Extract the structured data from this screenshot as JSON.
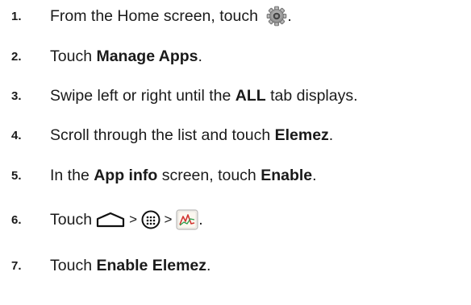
{
  "steps": [
    {
      "number": "1.",
      "before": "From the Home screen, touch ",
      "icon": "settings-gear-icon",
      "after": "."
    },
    {
      "number": "2.",
      "before": "Touch ",
      "bold": "Manage Apps",
      "after": "."
    },
    {
      "number": "3.",
      "before": "Swipe left or right until the ",
      "bold": "ALL",
      "after": " tab displays."
    },
    {
      "number": "4.",
      "before": "Scroll through the list and touch ",
      "bold": "Elemez",
      "after": "."
    },
    {
      "number": "5.",
      "before": "In the ",
      "bold": "App info",
      "middle": " screen, touch ",
      "bold2": "Enable",
      "after": "."
    },
    {
      "number": "6.",
      "before": "Touch ",
      "sep1": " > ",
      "sep2": " > ",
      "after": ".",
      "icons": [
        "home-icon",
        "all-apps-icon",
        "elemez-app-icon"
      ]
    },
    {
      "number": "7.",
      "before": "Touch ",
      "bold": "Enable Elemez",
      "after": "."
    }
  ]
}
